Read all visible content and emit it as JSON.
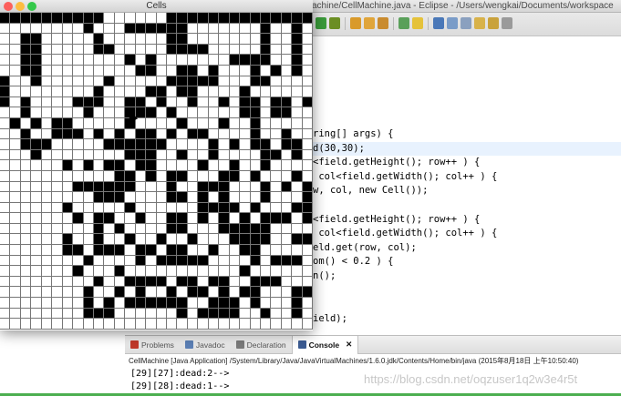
{
  "eclipse": {
    "title": "achine/CellMachine.java - Eclipse - /Users/wengkai/Documents/workspace",
    "code_lines": [
      {
        "text": "ring[] args) {",
        "highlight": false
      },
      {
        "text": "d(30,30);",
        "highlight": true
      },
      {
        "text": "<field.getHeight(); row++ ) {",
        "highlight": false
      },
      {
        "text": " col<field.getWidth(); col++ ) {",
        "highlight": false
      },
      {
        "text": "w, col, new Cell());",
        "highlight": false
      },
      {
        "text": "",
        "highlight": false
      },
      {
        "text": "<field.getHeight(); row++ ) {",
        "highlight": false
      },
      {
        "text": " col<field.getWidth(); col++ ) {",
        "highlight": false
      },
      {
        "text": "eld.get(row, col);",
        "highlight": false
      },
      {
        "text": "om() < 0.2 ) {",
        "highlight": false
      },
      {
        "text": "n();",
        "highlight": false
      },
      {
        "text": "",
        "highlight": false
      },
      {
        "text": "",
        "highlight": false
      },
      {
        "text": "ield);",
        "highlight": false
      }
    ],
    "panel_tabs": [
      {
        "label": "Problems",
        "active": false,
        "color": "#c0392b"
      },
      {
        "label": "Javadoc",
        "active": false,
        "color": "#5b7fb5"
      },
      {
        "label": "Declaration",
        "active": false,
        "color": "#7a7a7a"
      },
      {
        "label": "Console",
        "active": true,
        "color": "#3b5b92"
      }
    ],
    "console_close": "✕",
    "console_header": "CellMachine [Java Application] /System/Library/Java/JavaVirtualMachines/1.6.0.jdk/Contents/Home/bin/java (2015年8月18日 上午10:50:40)",
    "console_lines": [
      "[29][27]:dead:2-->",
      "[29][28]:dead:1-->"
    ],
    "watermark": "https://blog.csdn.net/oqzuser1q2w3e4r5t"
  },
  "cells_window": {
    "title": "Cells",
    "rows": 30,
    "cols": 30,
    "alive_rows": [
      "111111111100000011111111111111",
      "000000001000111111000000010010",
      "001100000100000011000000010010",
      "001100000110000011110000010010",
      "001100000000101000000011110010",
      "001100000000011001101000101010",
      "100100000010000011111000110000",
      "100000000100001101100001000000",
      "101000011100110100100101101101",
      "001000001000111010000001101100",
      "010101100000100001000100100000",
      "001001110101011010110000100100",
      "001110000011111100001010110110",
      "000100000000111001001000011010",
      "000000101011011000010010010000",
      "000000000001101011000110100010",
      "000000011111100010011100010101",
      "000000000111000011010100010001",
      "000000100000100000011110100011",
      "000000010110010011010101011101",
      "000000000101000011000111110000",
      "000000100100100100100011110011",
      "000000110111011011001001100000",
      "000000001000010111110000101110",
      "000000010001000000000001000000",
      "000000000100111101101100111000",
      "000000001001010010110101100011",
      "000000001010111111001110100010",
      "000000001110000001011110010010",
      "000000000000000000000000000000"
    ]
  },
  "colors": {
    "traffic_close": "#fc605c",
    "traffic_min": "#fdbc40",
    "traffic_max": "#34c84a"
  }
}
